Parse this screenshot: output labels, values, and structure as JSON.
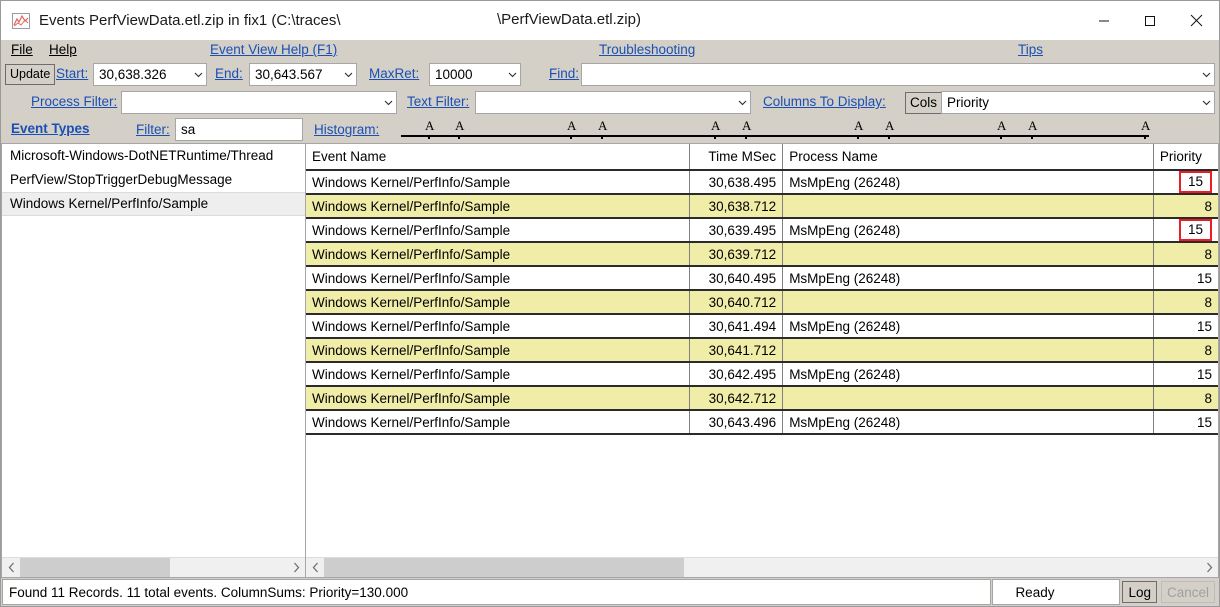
{
  "window": {
    "title_left": "Events PerfViewData.etl.zip in fix1 (C:\\traces\\",
    "title_right": "\\PerfViewData.etl.zip)",
    "icon": "chart-icon",
    "minimize": "minimize-icon",
    "maximize": "maximize-icon",
    "close": "close-icon"
  },
  "menu": {
    "file": "File",
    "help": "Help",
    "event_view_help": "Event View Help (F1)",
    "troubleshooting": "Troubleshooting",
    "tips": "Tips"
  },
  "toolbar": {
    "update_label": "Update",
    "start_label": "Start:",
    "start_value": "30,638.326",
    "end_label": "End:",
    "end_value": "30,643.567",
    "maxret_label": "MaxRet:",
    "maxret_value": "10000",
    "find_label": "Find:",
    "find_value": "",
    "process_filter_label": "Process Filter:",
    "process_filter_value": "",
    "text_filter_label": "Text Filter:",
    "text_filter_value": "",
    "columns_to_display_label": "Columns To Display:",
    "cols_label": "Cols",
    "columns_value": "Priority"
  },
  "left_panel": {
    "header": "Event Types",
    "filter_label": "Filter:",
    "filter_value": "sa",
    "items": [
      {
        "label": "Microsoft-Windows-DotNETRuntime/Thread",
        "selected": false
      },
      {
        "label": "PerfView/StopTriggerDebugMessage",
        "selected": false
      },
      {
        "label": "Windows Kernel/PerfInfo/Sample",
        "selected": true
      }
    ]
  },
  "histogram": {
    "label": "Histogram:",
    "markers": [
      "A",
      "A",
      "A",
      "A",
      "A",
      "A",
      "A",
      "A",
      "A",
      "A",
      "A"
    ]
  },
  "grid": {
    "columns": [
      "Event Name",
      "Time MSec",
      "Process Name",
      "Priority"
    ],
    "rows": [
      {
        "event_name": "Windows Kernel/PerfInfo/Sample",
        "time_msec": "30,638.495",
        "process_name": "MsMpEng (26248)",
        "priority": "15",
        "alt": false,
        "highlight": true
      },
      {
        "event_name": "Windows Kernel/PerfInfo/Sample",
        "time_msec": "30,638.712",
        "process_name": "",
        "priority": "8",
        "alt": true,
        "highlight": false
      },
      {
        "event_name": "Windows Kernel/PerfInfo/Sample",
        "time_msec": "30,639.495",
        "process_name": "MsMpEng (26248)",
        "priority": "15",
        "alt": false,
        "highlight": true
      },
      {
        "event_name": "Windows Kernel/PerfInfo/Sample",
        "time_msec": "30,639.712",
        "process_name": "",
        "priority": "8",
        "alt": true,
        "highlight": false
      },
      {
        "event_name": "Windows Kernel/PerfInfo/Sample",
        "time_msec": "30,640.495",
        "process_name": "MsMpEng (26248)",
        "priority": "15",
        "alt": false,
        "highlight": false
      },
      {
        "event_name": "Windows Kernel/PerfInfo/Sample",
        "time_msec": "30,640.712",
        "process_name": "",
        "priority": "8",
        "alt": true,
        "highlight": false
      },
      {
        "event_name": "Windows Kernel/PerfInfo/Sample",
        "time_msec": "30,641.494",
        "process_name": "MsMpEng (26248)",
        "priority": "15",
        "alt": false,
        "highlight": false
      },
      {
        "event_name": "Windows Kernel/PerfInfo/Sample",
        "time_msec": "30,641.712",
        "process_name": "",
        "priority": "8",
        "alt": true,
        "highlight": false
      },
      {
        "event_name": "Windows Kernel/PerfInfo/Sample",
        "time_msec": "30,642.495",
        "process_name": "MsMpEng (26248)",
        "priority": "15",
        "alt": false,
        "highlight": false
      },
      {
        "event_name": "Windows Kernel/PerfInfo/Sample",
        "time_msec": "30,642.712",
        "process_name": "",
        "priority": "8",
        "alt": true,
        "highlight": false
      },
      {
        "event_name": "Windows Kernel/PerfInfo/Sample",
        "time_msec": "30,643.496",
        "process_name": "MsMpEng (26248)",
        "priority": "15",
        "alt": false,
        "highlight": false
      }
    ]
  },
  "status": {
    "message": "Found 11 Records.  11 total events. ColumnSums: Priority=130.000",
    "ready": "Ready",
    "log_label": "Log",
    "cancel_label": "Cancel"
  },
  "colors": {
    "chrome": "#d4d0c8",
    "link": "#1a4fb4",
    "row_alt": "#f0eda8",
    "highlight_border": "#ee1c25"
  }
}
